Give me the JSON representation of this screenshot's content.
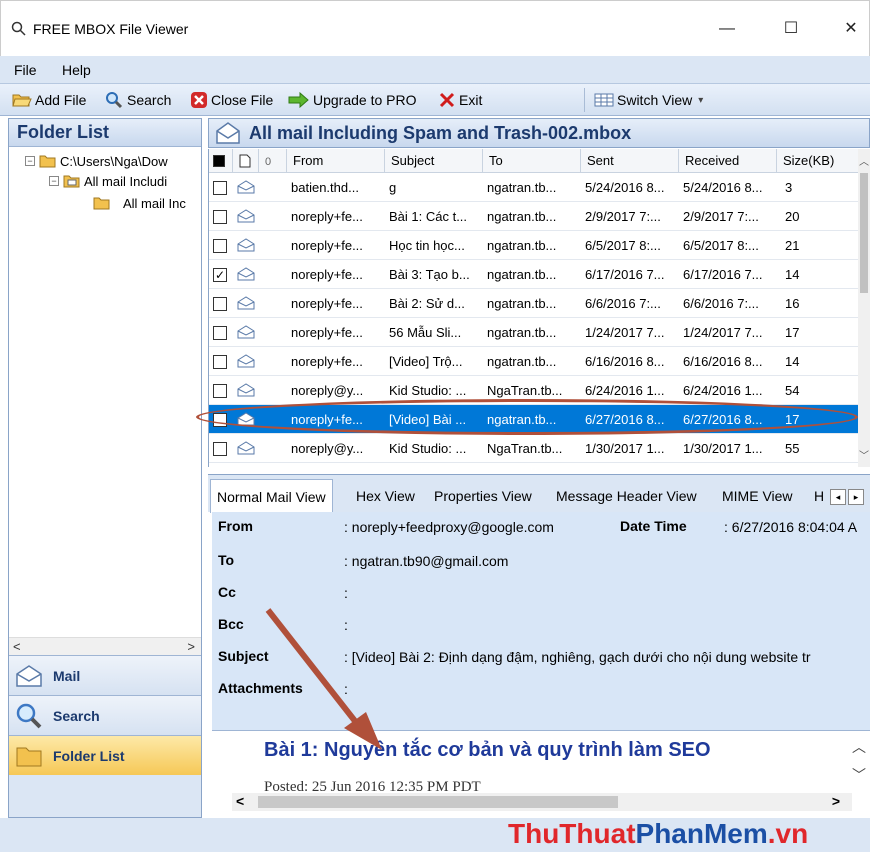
{
  "window": {
    "title": "FREE MBOX File Viewer",
    "minimize": "—",
    "maximize": "☐",
    "close": "✕"
  },
  "menu": {
    "file": "File",
    "help": "Help"
  },
  "toolbar": {
    "add_file": "Add File",
    "search": "Search",
    "close_file": "Close File",
    "upgrade": "Upgrade to PRO",
    "exit": "Exit",
    "switch_view": "Switch View",
    "switch_view_caret": "▾"
  },
  "folder_panel": {
    "title": "Folder List",
    "tree": [
      {
        "label": "C:\\Users\\Nga\\Dow",
        "expander": "−"
      },
      {
        "label": "All mail Includi",
        "expander": "−"
      },
      {
        "label": "All mail Inc"
      }
    ],
    "grip": "∙∙∙∙∙∙∙",
    "scroll_left": "<",
    "scroll_right": ">",
    "nav": {
      "mail": "Mail",
      "search": "Search",
      "folder_list": "Folder List"
    }
  },
  "mailbox": {
    "title": "All mail Including Spam and Trash-002.mbox",
    "columns": {
      "from": "From",
      "subject": "Subject",
      "to": "To",
      "sent": "Sent",
      "received": "Received",
      "size": "Size(KB)",
      "attach": "0"
    },
    "rows": [
      {
        "from": "batien.thd...",
        "subject": "g",
        "to": "ngatran.tb...",
        "sent": "5/24/2016 8...",
        "received": "5/24/2016 8...",
        "size": "3",
        "checked": ""
      },
      {
        "from": "noreply+fe...",
        "subject": "Bài 1: Các t...",
        "to": "ngatran.tb...",
        "sent": "2/9/2017 7:...",
        "received": "2/9/2017 7:...",
        "size": "20",
        "checked": ""
      },
      {
        "from": "noreply+fe...",
        "subject": "Học tin học...",
        "to": "ngatran.tb...",
        "sent": "6/5/2017 8:...",
        "received": "6/5/2017 8:...",
        "size": "21",
        "checked": ""
      },
      {
        "from": "noreply+fe...",
        "subject": "Bài 3: Tạo b...",
        "to": "ngatran.tb...",
        "sent": "6/17/2016 7...",
        "received": "6/17/2016 7...",
        "size": "14",
        "checked": "✓"
      },
      {
        "from": "noreply+fe...",
        "subject": "Bài 2: Sử d...",
        "to": "ngatran.tb...",
        "sent": "6/6/2016 7:...",
        "received": "6/6/2016 7:...",
        "size": "16",
        "checked": ""
      },
      {
        "from": "noreply+fe...",
        "subject": "56 Mẫu Sli...",
        "to": "ngatran.tb...",
        "sent": "1/24/2017 7...",
        "received": "1/24/2017 7...",
        "size": "17",
        "checked": ""
      },
      {
        "from": "noreply+fe...",
        "subject": "[Video] Trộ...",
        "to": "ngatran.tb...",
        "sent": "6/16/2016 8...",
        "received": "6/16/2016 8...",
        "size": "14",
        "checked": ""
      },
      {
        "from": "noreply@y...",
        "subject": "Kid Studio: ...",
        "to": "NgaTran.tb...",
        "sent": "6/24/2016 1...",
        "received": "6/24/2016 1...",
        "size": "54",
        "checked": ""
      },
      {
        "from": "noreply+fe...",
        "subject": "[Video] Bài ...",
        "to": "ngatran.tb...",
        "sent": "6/27/2016 8...",
        "received": "6/27/2016 8...",
        "size": "17",
        "checked": ""
      },
      {
        "from": "noreply@y...",
        "subject": "Kid Studio: ...",
        "to": "NgaTran.tb...",
        "sent": "1/30/2017 1...",
        "received": "1/30/2017 1...",
        "size": "55",
        "checked": ""
      }
    ],
    "selected_row": 8
  },
  "view_tabs": {
    "normal": "Normal Mail View",
    "hex": "Hex View",
    "properties": "Properties View",
    "header": "Message Header View",
    "mime": "MIME View",
    "html": "H",
    "prev": "◂",
    "next": "▸"
  },
  "details": {
    "from_label": "From",
    "from_value": ":  noreply+feedproxy@google.com",
    "datetime_label": "Date Time",
    "datetime_value": ":  6/27/2016 8:04:04 A",
    "to_label": "To",
    "to_value": ":  ngatran.tb90@gmail.com",
    "cc_label": "Cc",
    "cc_value": ":",
    "bcc_label": "Bcc",
    "bcc_value": ":",
    "subject_label": "Subject",
    "subject_value": ":  [Video] Bài 2: Định dạng đậm, nghiêng, gạch dưới cho nội dung website tr",
    "attachments_label": "Attachments",
    "attachments_value": ":"
  },
  "message_body": {
    "heading": "Bài 1: Nguyên tắc cơ bản và quy trình làm SEO",
    "posted": "Posted: 25 Jun 2016 12:35 PM PDT",
    "scroll_left": "<",
    "scroll_right": ">",
    "scroll_up": "︿",
    "scroll_down": "﹀"
  },
  "watermark": {
    "part1": "ThuThuat",
    "part2": "PhanMem",
    "part3": ".vn"
  },
  "colors": {
    "accent": "#0078d7",
    "panel": "#dbe6f4",
    "header_text": "#1c3a6e",
    "annotation": "#b0503a"
  }
}
